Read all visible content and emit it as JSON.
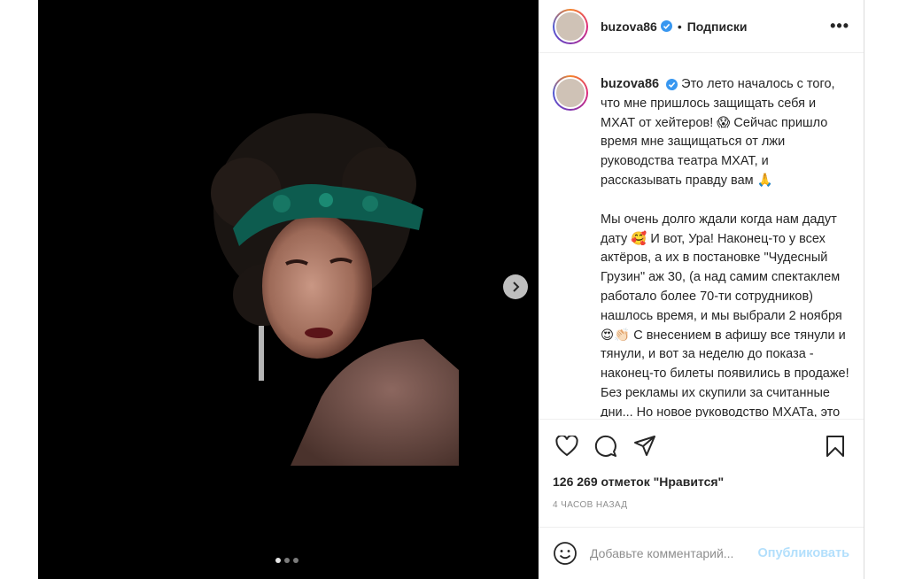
{
  "post": {
    "username": "buzova86",
    "follow_label": "Подписки",
    "separator": "•",
    "more_label": "•••"
  },
  "media": {
    "carousel_count": 3,
    "active_index": 0
  },
  "caption": {
    "username": "buzova86",
    "paragraph1": "Это лето началось с того, что мне пришлось защищать себя и МХАТ от хейтеров! 😱 Сейчас пришло время мне защищаться от лжи руководства театра МХАТ, и рассказывать правду вам 🙏",
    "paragraph2": "Мы очень долго ждали когда нам дадут дату 🥰 И вот, Ура! Наконец-то у всех актёров, а их в постановке \"Чудесный Грузин\" аж 30, (а над самим спектаклем работало более 70-ти сотрудников) нашлось время, и мы выбрали 2 ноября 😍👏🏻 С внесением в афишу все тянули и тянули, и вот за неделю до показа - наконец-то билеты появились в продаже! Без рекламы их скупили за считанные дни... Но новое руководство МХАТа, это не устроило! И господин Кехман дал задание снять"
  },
  "stats": {
    "likes": "126 269 отметок \"Нравится\"",
    "time": "4 ЧАСОВ НАЗАД"
  },
  "comment_box": {
    "placeholder": "Добавьте комментарий...",
    "publish_label": "Опубликовать"
  },
  "colors": {
    "verified": "#3897f0",
    "publish_disabled": "#b2dffc",
    "muted_text": "#8e8e8e"
  }
}
